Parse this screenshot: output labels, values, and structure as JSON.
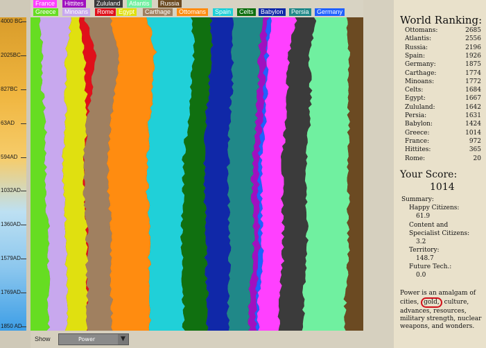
{
  "legend": [
    {
      "name": "France",
      "color": "#ff40ff"
    },
    {
      "name": "Hittites",
      "color": "#a010c0"
    },
    {
      "name": "Zululand",
      "color": "#3b3b3b"
    },
    {
      "name": "Atlantis",
      "color": "#70f0a0"
    },
    {
      "name": "Russia",
      "color": "#6b4a22"
    },
    {
      "name": "Greece",
      "color": "#66dd22"
    },
    {
      "name": "Minoans",
      "color": "#c8a8ee"
    },
    {
      "name": "Rome",
      "color": "#e0101a"
    },
    {
      "name": "Egypt",
      "color": "#e0e010"
    },
    {
      "name": "Carthage",
      "color": "#a08060"
    },
    {
      "name": "Ottomans",
      "color": "#ff8c10"
    },
    {
      "name": "Spain",
      "color": "#20d0d8"
    },
    {
      "name": "Celts",
      "color": "#107010"
    },
    {
      "name": "Babylon",
      "color": "#1028a8"
    },
    {
      "name": "Persia",
      "color": "#208888"
    },
    {
      "name": "Germany",
      "color": "#2060ff"
    }
  ],
  "time_axis": [
    "4000 BC",
    "2025BC",
    "827BC",
    "63AD",
    "594AD",
    "1032AD",
    "1360AD",
    "1579AD",
    "1769AD",
    "1850 AD"
  ],
  "chart_data": {
    "type": "area",
    "stacked": true,
    "x": [
      "4000 BC",
      "2025BC",
      "827BC",
      "63AD",
      "594AD",
      "1032AD",
      "1360AD",
      "1579AD",
      "1769AD",
      "1850 AD"
    ],
    "series": [
      {
        "name": "Greece",
        "color": "#66dd22",
        "values": [
          3,
          4,
          4,
          5,
          5,
          5,
          6,
          6,
          6,
          6
        ]
      },
      {
        "name": "Minoans",
        "color": "#c8a8ee",
        "values": [
          10,
          8,
          8,
          7,
          6,
          6,
          6,
          6,
          6,
          6
        ]
      },
      {
        "name": "Egypt",
        "color": "#e0e010",
        "values": [
          2,
          6,
          7,
          7,
          7,
          7,
          7,
          7,
          7,
          7
        ]
      },
      {
        "name": "Rome",
        "color": "#e0101a",
        "values": [
          2,
          4,
          2,
          0,
          0,
          0,
          0,
          0,
          0,
          0
        ]
      },
      {
        "name": "Carthage",
        "color": "#a08060",
        "values": [
          8,
          8,
          8,
          8,
          8,
          8,
          8,
          8,
          8,
          8
        ]
      },
      {
        "name": "Ottomans",
        "color": "#ff8c10",
        "values": [
          12,
          12,
          13,
          13,
          13,
          13,
          13,
          13,
          13,
          13
        ]
      },
      {
        "name": "Spain",
        "color": "#20d0d8",
        "values": [
          14,
          13,
          13,
          13,
          12,
          12,
          11,
          11,
          11,
          11
        ]
      },
      {
        "name": "Celts",
        "color": "#107010",
        "values": [
          6,
          6,
          6,
          6,
          7,
          7,
          8,
          8,
          8,
          8
        ]
      },
      {
        "name": "Babylon",
        "color": "#1028a8",
        "values": [
          7,
          7,
          8,
          8,
          8,
          8,
          8,
          8,
          7,
          7
        ]
      },
      {
        "name": "Persia",
        "color": "#208888",
        "values": [
          9,
          9,
          9,
          9,
          8,
          8,
          8,
          8,
          7,
          7
        ]
      },
      {
        "name": "Hittites",
        "color": "#a010c0",
        "values": [
          2,
          2,
          2,
          2,
          2,
          2,
          2,
          2,
          2,
          2
        ]
      },
      {
        "name": "Germany",
        "color": "#2060ff",
        "values": [
          1,
          1,
          1,
          1,
          1,
          1,
          1,
          1,
          1,
          1
        ]
      },
      {
        "name": "France",
        "color": "#ff40ff",
        "values": [
          8,
          7,
          7,
          7,
          7,
          7,
          7,
          7,
          7,
          7
        ]
      },
      {
        "name": "Zululand",
        "color": "#3b3b3b",
        "values": [
          6,
          7,
          8,
          8,
          8,
          8,
          8,
          8,
          8,
          8
        ]
      },
      {
        "name": "Atlantis",
        "color": "#70f0a0",
        "values": [
          10,
          13,
          13,
          13,
          14,
          14,
          14,
          14,
          14,
          14
        ]
      },
      {
        "name": "Russia",
        "color": "#6b4a22",
        "values": [
          5,
          5,
          5,
          5,
          5,
          5,
          5,
          5,
          6,
          6
        ]
      }
    ]
  },
  "show": {
    "label": "Show",
    "value": "Power"
  },
  "ranking": {
    "title": "World Ranking:",
    "rows": [
      {
        "name": "Ottomans:",
        "score": "2685"
      },
      {
        "name": "Atlantis:",
        "score": "2556"
      },
      {
        "name": "Russia:",
        "score": "2196"
      },
      {
        "name": "Spain:",
        "score": "1926"
      },
      {
        "name": "Germany:",
        "score": "1875"
      },
      {
        "name": "Carthage:",
        "score": "1774"
      },
      {
        "name": "Minoans:",
        "score": "1772"
      },
      {
        "name": "Celts:",
        "score": "1684"
      },
      {
        "name": "Egypt:",
        "score": "1667"
      },
      {
        "name": "Zululand:",
        "score": "1642"
      },
      {
        "name": "Persia:",
        "score": "1631"
      },
      {
        "name": "Babylon:",
        "score": "1424"
      },
      {
        "name": "Greece:",
        "score": "1014"
      },
      {
        "name": "France:",
        "score": "972"
      },
      {
        "name": "Hittites:",
        "score": "365"
      },
      {
        "name": "Rome:",
        "score": "20"
      }
    ]
  },
  "score": {
    "title": "Your Score:",
    "value": "1014"
  },
  "summary": {
    "title": "Summary:",
    "happy_label": "Happy Citizens:",
    "happy_value": "61.9",
    "content_label1": "Content and",
    "content_label2": "Specialist Citizens:",
    "content_value": "3.2",
    "territory_label": "Territory:",
    "territory_value": "148.7",
    "future_label": "Future Tech.:",
    "future_value": "0.0"
  },
  "description": {
    "pre": "Power is an amalgam of cities,",
    "highlight": "gold,",
    "post": "culture, advances, resources, military strength, nuclear weapons, and wonders."
  }
}
